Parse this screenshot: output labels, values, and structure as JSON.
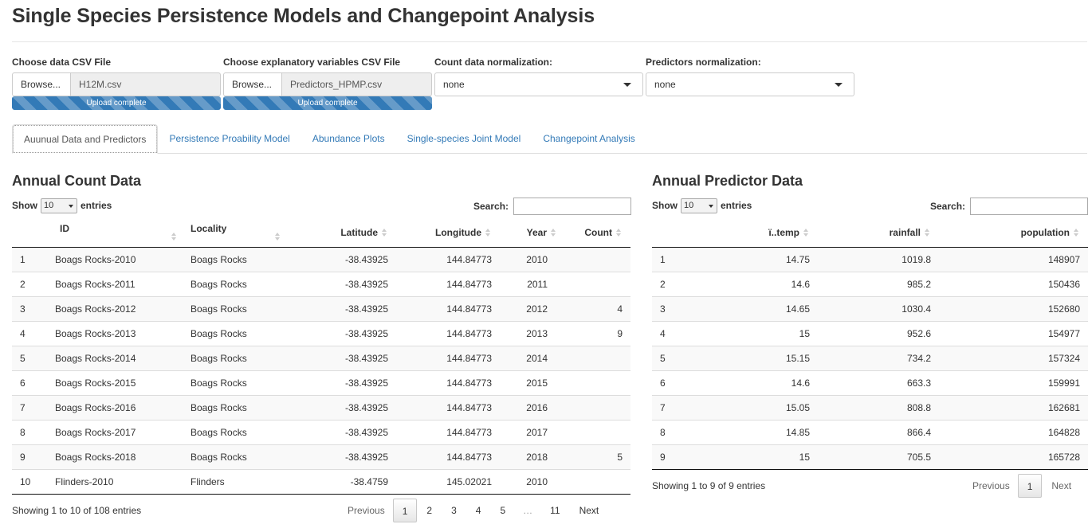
{
  "page_title": "Single Species Persistence Models and Changepoint Analysis",
  "inputs": {
    "data_file": {
      "label": "Choose data CSV File",
      "browse": "Browse...",
      "filename": "H12M.csv",
      "progress_text": "Upload complete",
      "progress": 1.0
    },
    "predictors_file": {
      "label": "Choose explanatory variables CSV File",
      "browse": "Browse...",
      "filename": "Predictors_HPMP.csv",
      "progress_text": "Upload complete",
      "progress": 1.0
    },
    "count_norm": {
      "label": "Count data normalization:",
      "value": "none"
    },
    "pred_norm": {
      "label": "Predictors normalization:",
      "value": "none"
    }
  },
  "tabs": [
    {
      "label": "Auunual Data and Predictors",
      "active": true
    },
    {
      "label": "Persistence Proability Model",
      "active": false
    },
    {
      "label": "Abundance Plots",
      "active": false
    },
    {
      "label": "Single-species Joint Model",
      "active": false
    },
    {
      "label": "Changepoint Analysis",
      "active": false
    }
  ],
  "count_table": {
    "title": "Annual Count Data",
    "show": "Show",
    "entries": "entries",
    "length": "10",
    "search_label": "Search:",
    "columns": [
      "ID",
      "Locality",
      "Latitude",
      "Longitude",
      "Year",
      "Count"
    ],
    "rows": [
      [
        "1",
        "Boags Rocks-2010",
        "Boags Rocks",
        "-38.43925",
        "144.84773",
        "2010",
        ""
      ],
      [
        "2",
        "Boags Rocks-2011",
        "Boags Rocks",
        "-38.43925",
        "144.84773",
        "2011",
        ""
      ],
      [
        "3",
        "Boags Rocks-2012",
        "Boags Rocks",
        "-38.43925",
        "144.84773",
        "2012",
        "4"
      ],
      [
        "4",
        "Boags Rocks-2013",
        "Boags Rocks",
        "-38.43925",
        "144.84773",
        "2013",
        "9"
      ],
      [
        "5",
        "Boags Rocks-2014",
        "Boags Rocks",
        "-38.43925",
        "144.84773",
        "2014",
        ""
      ],
      [
        "6",
        "Boags Rocks-2015",
        "Boags Rocks",
        "-38.43925",
        "144.84773",
        "2015",
        ""
      ],
      [
        "7",
        "Boags Rocks-2016",
        "Boags Rocks",
        "-38.43925",
        "144.84773",
        "2016",
        ""
      ],
      [
        "8",
        "Boags Rocks-2017",
        "Boags Rocks",
        "-38.43925",
        "144.84773",
        "2017",
        ""
      ],
      [
        "9",
        "Boags Rocks-2018",
        "Boags Rocks",
        "-38.43925",
        "144.84773",
        "2018",
        "5"
      ],
      [
        "10",
        "Flinders-2010",
        "Flinders",
        "-38.4759",
        "145.02021",
        "2010",
        ""
      ]
    ],
    "info": "Showing 1 to 10 of 108 entries",
    "pager": {
      "previous": "Previous",
      "pages": [
        "1",
        "2",
        "3",
        "4",
        "5"
      ],
      "ellipsis": "…",
      "last": "11",
      "next": "Next",
      "current": "1"
    }
  },
  "predictor_table": {
    "title": "Annual Predictor Data",
    "show": "Show",
    "entries": "entries",
    "length": "10",
    "search_label": "Search:",
    "columns": [
      "ï..temp",
      "rainfall",
      "population"
    ],
    "rows": [
      [
        "1",
        "14.75",
        "1019.8",
        "148907"
      ],
      [
        "2",
        "14.6",
        "985.2",
        "150436"
      ],
      [
        "3",
        "14.65",
        "1030.4",
        "152680"
      ],
      [
        "4",
        "15",
        "952.6",
        "154977"
      ],
      [
        "5",
        "15.15",
        "734.2",
        "157324"
      ],
      [
        "6",
        "14.6",
        "663.3",
        "159991"
      ],
      [
        "7",
        "15.05",
        "808.8",
        "162681"
      ],
      [
        "8",
        "14.85",
        "866.4",
        "164828"
      ],
      [
        "9",
        "15",
        "705.5",
        "165728"
      ]
    ],
    "info": "Showing 1 to 9 of 9 entries",
    "pager": {
      "previous": "Previous",
      "current": "1",
      "next": "Next"
    }
  },
  "colors": {
    "link": "#337ab7",
    "progress": "#337ab7",
    "text": "#333333"
  }
}
